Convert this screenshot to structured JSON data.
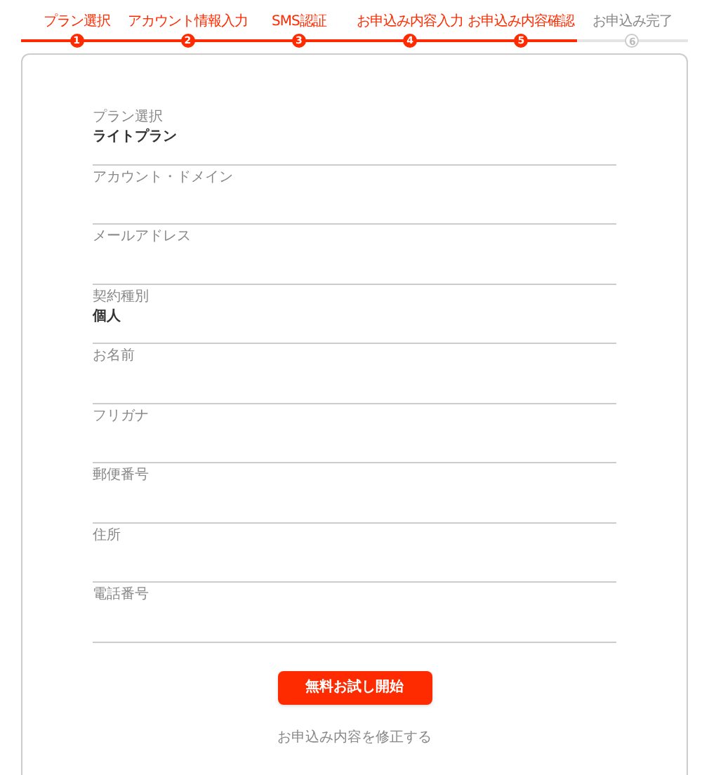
{
  "steps": [
    {
      "label": "プラン選択",
      "number": "1",
      "done": true
    },
    {
      "label": "アカウント情報入力",
      "number": "2",
      "done": true
    },
    {
      "label": "SMS認証",
      "number": "3",
      "done": true
    },
    {
      "label": "お申込み内容入力",
      "number": "4",
      "done": true
    },
    {
      "label": "お申込み内容確認",
      "number": "5",
      "done": true
    },
    {
      "label": "お申込み完了",
      "number": "6",
      "done": false
    }
  ],
  "fields": [
    {
      "label": "プラン選択",
      "value": "ライトプラン"
    },
    {
      "label": "アカウント・ドメイン"
    },
    {
      "label": "メールアドレス"
    },
    {
      "label": "契約種別",
      "value": "個人"
    },
    {
      "label": "お名前"
    },
    {
      "label": "フリガナ"
    },
    {
      "label": "郵便番号"
    },
    {
      "label": "住所"
    },
    {
      "label": "電話番号"
    }
  ],
  "submit_button": "無料お試し開始",
  "edit_link": "お申込み内容を修正する"
}
